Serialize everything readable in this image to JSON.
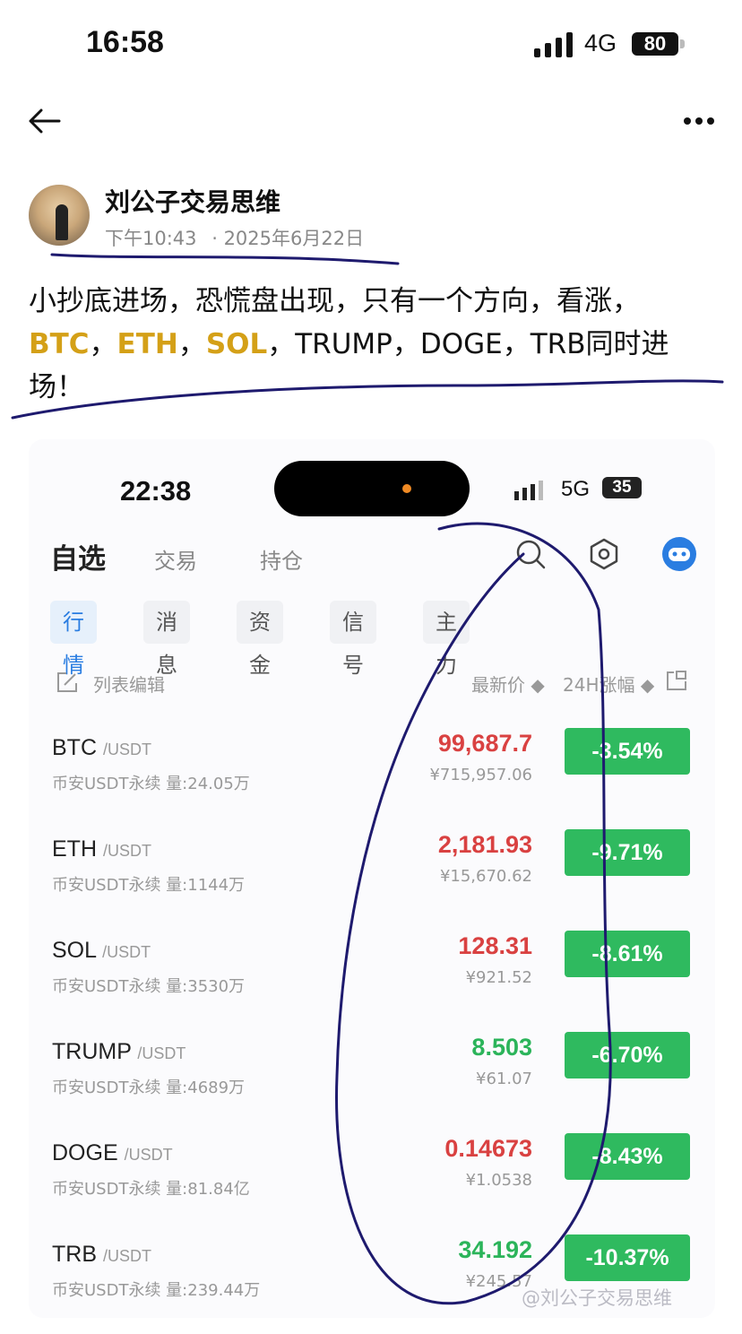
{
  "status_bar": {
    "time": "16:58",
    "network": "4G",
    "battery": "80"
  },
  "post": {
    "author": "刘公子交易思维",
    "time": "下午10:43",
    "date": "· 2025年6月22日",
    "text_line1": "小抄底进场，恐慌盘出现，只有一个方向，看涨，",
    "coins_highlight": [
      "BTC",
      "ETH",
      "SOL"
    ],
    "text_line2_rest": "TRUMP，DOGE，TRB同时进",
    "text_line3": "场！",
    "sep": "，"
  },
  "screenshot": {
    "status_time": "22:38",
    "status_network": "5G",
    "status_battery": "35",
    "tabs": {
      "main": "自选",
      "trade": "交易",
      "positions": "持仓"
    },
    "subtabs": [
      "行情",
      "消息",
      "资金",
      "信号",
      "主力"
    ],
    "list_header": {
      "edit": "列表编辑",
      "price": "最新价 ◆",
      "change": "24H涨幅 ◆"
    },
    "rows": [
      {
        "symbol": "BTC",
        "quote": "/USDT",
        "volume": "币安USDT永续 量:24.05万",
        "price": "99,687.7",
        "price_color": "red",
        "cny": "¥715,957.06",
        "change": "-3.54%"
      },
      {
        "symbol": "ETH",
        "quote": "/USDT",
        "volume": "币安USDT永续 量:1144万",
        "price": "2,181.93",
        "price_color": "red",
        "cny": "¥15,670.62",
        "change": "-9.71%"
      },
      {
        "symbol": "SOL",
        "quote": "/USDT",
        "volume": "币安USDT永续 量:3530万",
        "price": "128.31",
        "price_color": "red",
        "cny": "¥921.52",
        "change": "-8.61%"
      },
      {
        "symbol": "TRUMP",
        "quote": "/USDT",
        "volume": "币安USDT永续 量:4689万",
        "price": "8.503",
        "price_color": "green",
        "cny": "¥61.07",
        "change": "-6.70%"
      },
      {
        "symbol": "DOGE",
        "quote": "/USDT",
        "volume": "币安USDT永续 量:81.84亿",
        "price": "0.14673",
        "price_color": "red",
        "cny": "¥1.0538",
        "change": "-8.43%"
      },
      {
        "symbol": "TRB",
        "quote": "/USDT",
        "volume": "币安USDT永续 量:239.44万",
        "price": "34.192",
        "price_color": "green",
        "cny": "¥245.57",
        "change": "-10.37%"
      }
    ]
  },
  "watermark": "@刘公子交易思维",
  "colors": {
    "highlight": "#d4a017",
    "down_badge": "#2fba5f",
    "price_red": "#d94141",
    "price_green": "#2bb45a",
    "annotation_ink": "#1e1a6e"
  }
}
